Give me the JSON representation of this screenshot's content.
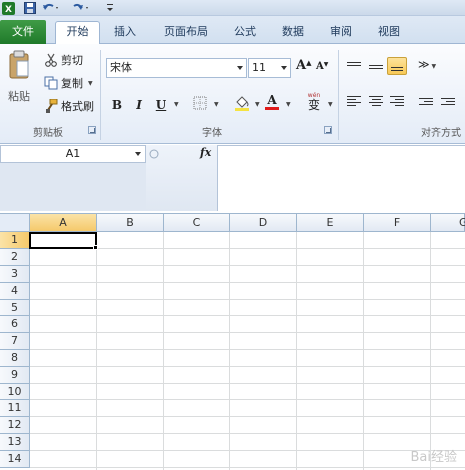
{
  "quick_access": {
    "icons": [
      "excel-logo-icon",
      "save-icon",
      "undo-icon",
      "redo-icon",
      "customize-icon"
    ]
  },
  "tabs": [
    {
      "label": "文件",
      "kind": "file"
    },
    {
      "label": "开始",
      "kind": "active"
    },
    {
      "label": "插入",
      "kind": "normal"
    },
    {
      "label": "页面布局",
      "kind": "normal"
    },
    {
      "label": "公式",
      "kind": "normal"
    },
    {
      "label": "数据",
      "kind": "normal"
    },
    {
      "label": "审阅",
      "kind": "normal"
    },
    {
      "label": "视图",
      "kind": "normal"
    }
  ],
  "ribbon": {
    "clipboard": {
      "paste_label": "粘贴",
      "cut_label": "剪切",
      "copy_label": "复制",
      "format_painter_label": "格式刷",
      "group_label": "剪贴板"
    },
    "font": {
      "font_name": "宋体",
      "font_size": "11",
      "grow_label": "A",
      "shrink_label": "A",
      "bold": "B",
      "italic": "I",
      "underline": "U",
      "font_color_letter": "A",
      "phonetic_label": "变",
      "group_label": "字体",
      "font_color": "#e01b1b",
      "highlight_color": "#f5e342"
    },
    "alignment": {
      "group_label": "对齐方式"
    }
  },
  "formula_bar": {
    "name_box": "A1",
    "fx_label": "fx",
    "formula": ""
  },
  "sheet": {
    "columns": [
      "A",
      "B",
      "C",
      "D",
      "E",
      "F",
      "G"
    ],
    "rows": [
      "1",
      "2",
      "3",
      "4",
      "5",
      "6",
      "7",
      "8",
      "9",
      "10",
      "11",
      "12",
      "13",
      "14"
    ],
    "selected_cell": "A1"
  },
  "watermark": "Bai经验"
}
